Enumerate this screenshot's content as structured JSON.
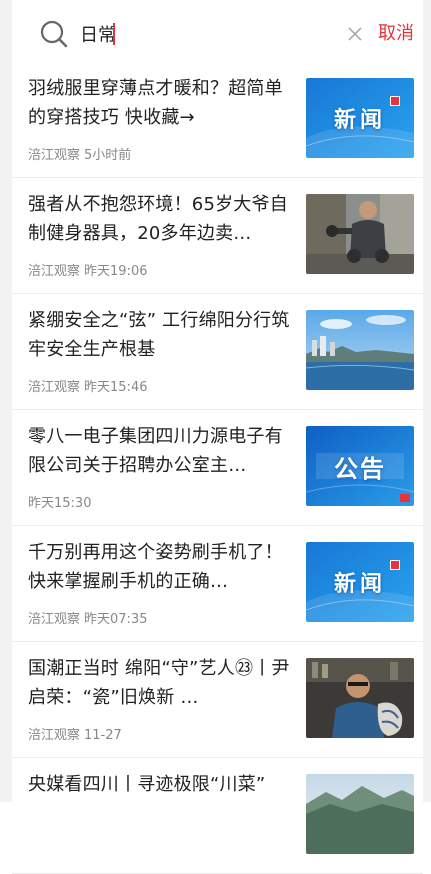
{
  "search": {
    "value": "日常",
    "cancel_label": "取消"
  },
  "icons": {
    "search": "search-icon",
    "clear": "close-icon"
  },
  "colors": {
    "accent": "#e5343c",
    "news_blue": "#1e8de0",
    "text": "#222222",
    "meta": "#888888"
  },
  "news": [
    {
      "title": "羽绒服里穿薄点才暖和？超简单的穿搭技巧 快收藏→",
      "source": "涪江观察",
      "time": "5小时前",
      "thumb_type": "news",
      "thumb_text": "新闻"
    },
    {
      "title": "强者从不抱怨环境！65岁大爷自制健身器具，20多年边卖…",
      "source": "涪江观察",
      "time": "昨天19:06",
      "thumb_type": "photo-man-dumbbell"
    },
    {
      "title": "紧绷安全之“弦” 工行绵阳分行筑牢安全生产根基",
      "source": "涪江观察",
      "time": "昨天15:46",
      "thumb_type": "photo-city-river"
    },
    {
      "title": "零八一电子集团四川力源电子有限公司关于招聘办公室主…",
      "source": "",
      "time": "昨天15:30",
      "thumb_type": "notice",
      "thumb_text": "公告"
    },
    {
      "title": "千万别再用这个姿势刷手机了！快来掌握刷手机的正确…",
      "source": "涪江观察",
      "time": "昨天07:35",
      "thumb_type": "news",
      "thumb_text": "新闻"
    },
    {
      "title": "国潮正当时 绵阳“守”艺人㉓丨尹启荣：“瓷”旧焕新 …",
      "source": "涪江观察",
      "time": "11-27",
      "thumb_type": "photo-artisan-porcelain"
    },
    {
      "title": "央媒看四川丨寻迹极限“川菜”",
      "source": "",
      "time": "",
      "thumb_type": "photo-mountains"
    }
  ]
}
